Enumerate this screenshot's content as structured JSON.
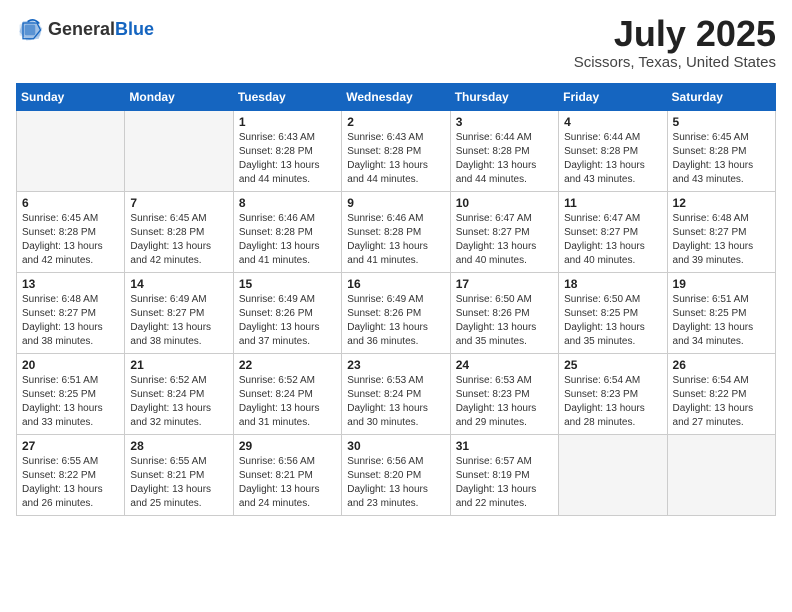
{
  "header": {
    "logo_general": "General",
    "logo_blue": "Blue",
    "month_title": "July 2025",
    "location": "Scissors, Texas, United States"
  },
  "weekdays": [
    "Sunday",
    "Monday",
    "Tuesday",
    "Wednesday",
    "Thursday",
    "Friday",
    "Saturday"
  ],
  "weeks": [
    [
      {
        "day": "",
        "text": ""
      },
      {
        "day": "",
        "text": ""
      },
      {
        "day": "1",
        "text": "Sunrise: 6:43 AM\nSunset: 8:28 PM\nDaylight: 13 hours and 44 minutes."
      },
      {
        "day": "2",
        "text": "Sunrise: 6:43 AM\nSunset: 8:28 PM\nDaylight: 13 hours and 44 minutes."
      },
      {
        "day": "3",
        "text": "Sunrise: 6:44 AM\nSunset: 8:28 PM\nDaylight: 13 hours and 44 minutes."
      },
      {
        "day": "4",
        "text": "Sunrise: 6:44 AM\nSunset: 8:28 PM\nDaylight: 13 hours and 43 minutes."
      },
      {
        "day": "5",
        "text": "Sunrise: 6:45 AM\nSunset: 8:28 PM\nDaylight: 13 hours and 43 minutes."
      }
    ],
    [
      {
        "day": "6",
        "text": "Sunrise: 6:45 AM\nSunset: 8:28 PM\nDaylight: 13 hours and 42 minutes."
      },
      {
        "day": "7",
        "text": "Sunrise: 6:45 AM\nSunset: 8:28 PM\nDaylight: 13 hours and 42 minutes."
      },
      {
        "day": "8",
        "text": "Sunrise: 6:46 AM\nSunset: 8:28 PM\nDaylight: 13 hours and 41 minutes."
      },
      {
        "day": "9",
        "text": "Sunrise: 6:46 AM\nSunset: 8:28 PM\nDaylight: 13 hours and 41 minutes."
      },
      {
        "day": "10",
        "text": "Sunrise: 6:47 AM\nSunset: 8:27 PM\nDaylight: 13 hours and 40 minutes."
      },
      {
        "day": "11",
        "text": "Sunrise: 6:47 AM\nSunset: 8:27 PM\nDaylight: 13 hours and 40 minutes."
      },
      {
        "day": "12",
        "text": "Sunrise: 6:48 AM\nSunset: 8:27 PM\nDaylight: 13 hours and 39 minutes."
      }
    ],
    [
      {
        "day": "13",
        "text": "Sunrise: 6:48 AM\nSunset: 8:27 PM\nDaylight: 13 hours and 38 minutes."
      },
      {
        "day": "14",
        "text": "Sunrise: 6:49 AM\nSunset: 8:27 PM\nDaylight: 13 hours and 38 minutes."
      },
      {
        "day": "15",
        "text": "Sunrise: 6:49 AM\nSunset: 8:26 PM\nDaylight: 13 hours and 37 minutes."
      },
      {
        "day": "16",
        "text": "Sunrise: 6:49 AM\nSunset: 8:26 PM\nDaylight: 13 hours and 36 minutes."
      },
      {
        "day": "17",
        "text": "Sunrise: 6:50 AM\nSunset: 8:26 PM\nDaylight: 13 hours and 35 minutes."
      },
      {
        "day": "18",
        "text": "Sunrise: 6:50 AM\nSunset: 8:25 PM\nDaylight: 13 hours and 35 minutes."
      },
      {
        "day": "19",
        "text": "Sunrise: 6:51 AM\nSunset: 8:25 PM\nDaylight: 13 hours and 34 minutes."
      }
    ],
    [
      {
        "day": "20",
        "text": "Sunrise: 6:51 AM\nSunset: 8:25 PM\nDaylight: 13 hours and 33 minutes."
      },
      {
        "day": "21",
        "text": "Sunrise: 6:52 AM\nSunset: 8:24 PM\nDaylight: 13 hours and 32 minutes."
      },
      {
        "day": "22",
        "text": "Sunrise: 6:52 AM\nSunset: 8:24 PM\nDaylight: 13 hours and 31 minutes."
      },
      {
        "day": "23",
        "text": "Sunrise: 6:53 AM\nSunset: 8:24 PM\nDaylight: 13 hours and 30 minutes."
      },
      {
        "day": "24",
        "text": "Sunrise: 6:53 AM\nSunset: 8:23 PM\nDaylight: 13 hours and 29 minutes."
      },
      {
        "day": "25",
        "text": "Sunrise: 6:54 AM\nSunset: 8:23 PM\nDaylight: 13 hours and 28 minutes."
      },
      {
        "day": "26",
        "text": "Sunrise: 6:54 AM\nSunset: 8:22 PM\nDaylight: 13 hours and 27 minutes."
      }
    ],
    [
      {
        "day": "27",
        "text": "Sunrise: 6:55 AM\nSunset: 8:22 PM\nDaylight: 13 hours and 26 minutes."
      },
      {
        "day": "28",
        "text": "Sunrise: 6:55 AM\nSunset: 8:21 PM\nDaylight: 13 hours and 25 minutes."
      },
      {
        "day": "29",
        "text": "Sunrise: 6:56 AM\nSunset: 8:21 PM\nDaylight: 13 hours and 24 minutes."
      },
      {
        "day": "30",
        "text": "Sunrise: 6:56 AM\nSunset: 8:20 PM\nDaylight: 13 hours and 23 minutes."
      },
      {
        "day": "31",
        "text": "Sunrise: 6:57 AM\nSunset: 8:19 PM\nDaylight: 13 hours and 22 minutes."
      },
      {
        "day": "",
        "text": ""
      },
      {
        "day": "",
        "text": ""
      }
    ]
  ]
}
